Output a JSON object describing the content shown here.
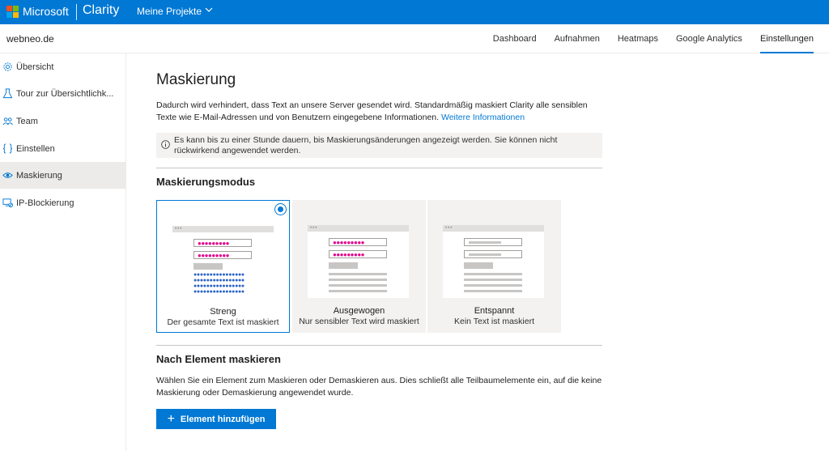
{
  "topbar": {
    "brand": "Microsoft",
    "product": "Clarity",
    "projects_label": "Meine Projekte",
    "logo_colors": [
      "#f25022",
      "#7fba00",
      "#00a4ef",
      "#ffb900"
    ]
  },
  "subheader": {
    "site_name": "webneo.de",
    "tabs": [
      {
        "label": "Dashboard",
        "active": false
      },
      {
        "label": "Aufnahmen",
        "active": false
      },
      {
        "label": "Heatmaps",
        "active": false
      },
      {
        "label": "Google Analytics",
        "active": false
      },
      {
        "label": "Einstellungen",
        "active": true
      }
    ]
  },
  "sidebar": {
    "items": [
      {
        "label": "Übersicht",
        "icon": "gear-icon"
      },
      {
        "label": "Tour zur Übersichtlichk...",
        "icon": "flask-icon"
      },
      {
        "label": "Team",
        "icon": "people-icon"
      },
      {
        "label": "Einstellen",
        "icon": "code-braces-icon"
      },
      {
        "label": "Maskierung",
        "icon": "eye-mask-icon",
        "active": true
      },
      {
        "label": "IP-Blockierung",
        "icon": "monitor-block-icon"
      }
    ]
  },
  "main": {
    "title": "Maskierung",
    "description": "Dadurch wird verhindert, dass Text an unsere Server gesendet wird. Standardmäßig maskiert Clarity alle sensiblen Texte wie E-Mail-Adressen und von Benutzern eingegebene Informationen.",
    "more_info_link": "Weitere Informationen",
    "info_notice": "Es kann bis zu einer Stunde dauern, bis Maskierungsänderungen angezeigt werden. Sie können nicht rückwirkend angewendet werden.",
    "mode_heading": "Maskierungsmodus",
    "modes": [
      {
        "name": "Streng",
        "subtitle": "Der gesamte Text ist maskiert",
        "selected": true
      },
      {
        "name": "Ausgewogen",
        "subtitle": "Nur sensibler Text wird maskiert",
        "selected": false
      },
      {
        "name": "Entspannt",
        "subtitle": "Kein Text ist maskiert",
        "selected": false
      }
    ],
    "element_heading": "Nach Element maskieren",
    "element_description": "Wählen Sie ein Element zum Maskieren oder Demaskieren aus. Dies schließt alle Teilbaumelemente ein, auf die keine Maskierung oder Demaskierung angewendet wurde.",
    "add_button": "Element hinzufügen"
  },
  "colors": {
    "accent": "#0078d4",
    "mask_pink": "#e3008c",
    "mask_blue": "#2b63c6"
  }
}
